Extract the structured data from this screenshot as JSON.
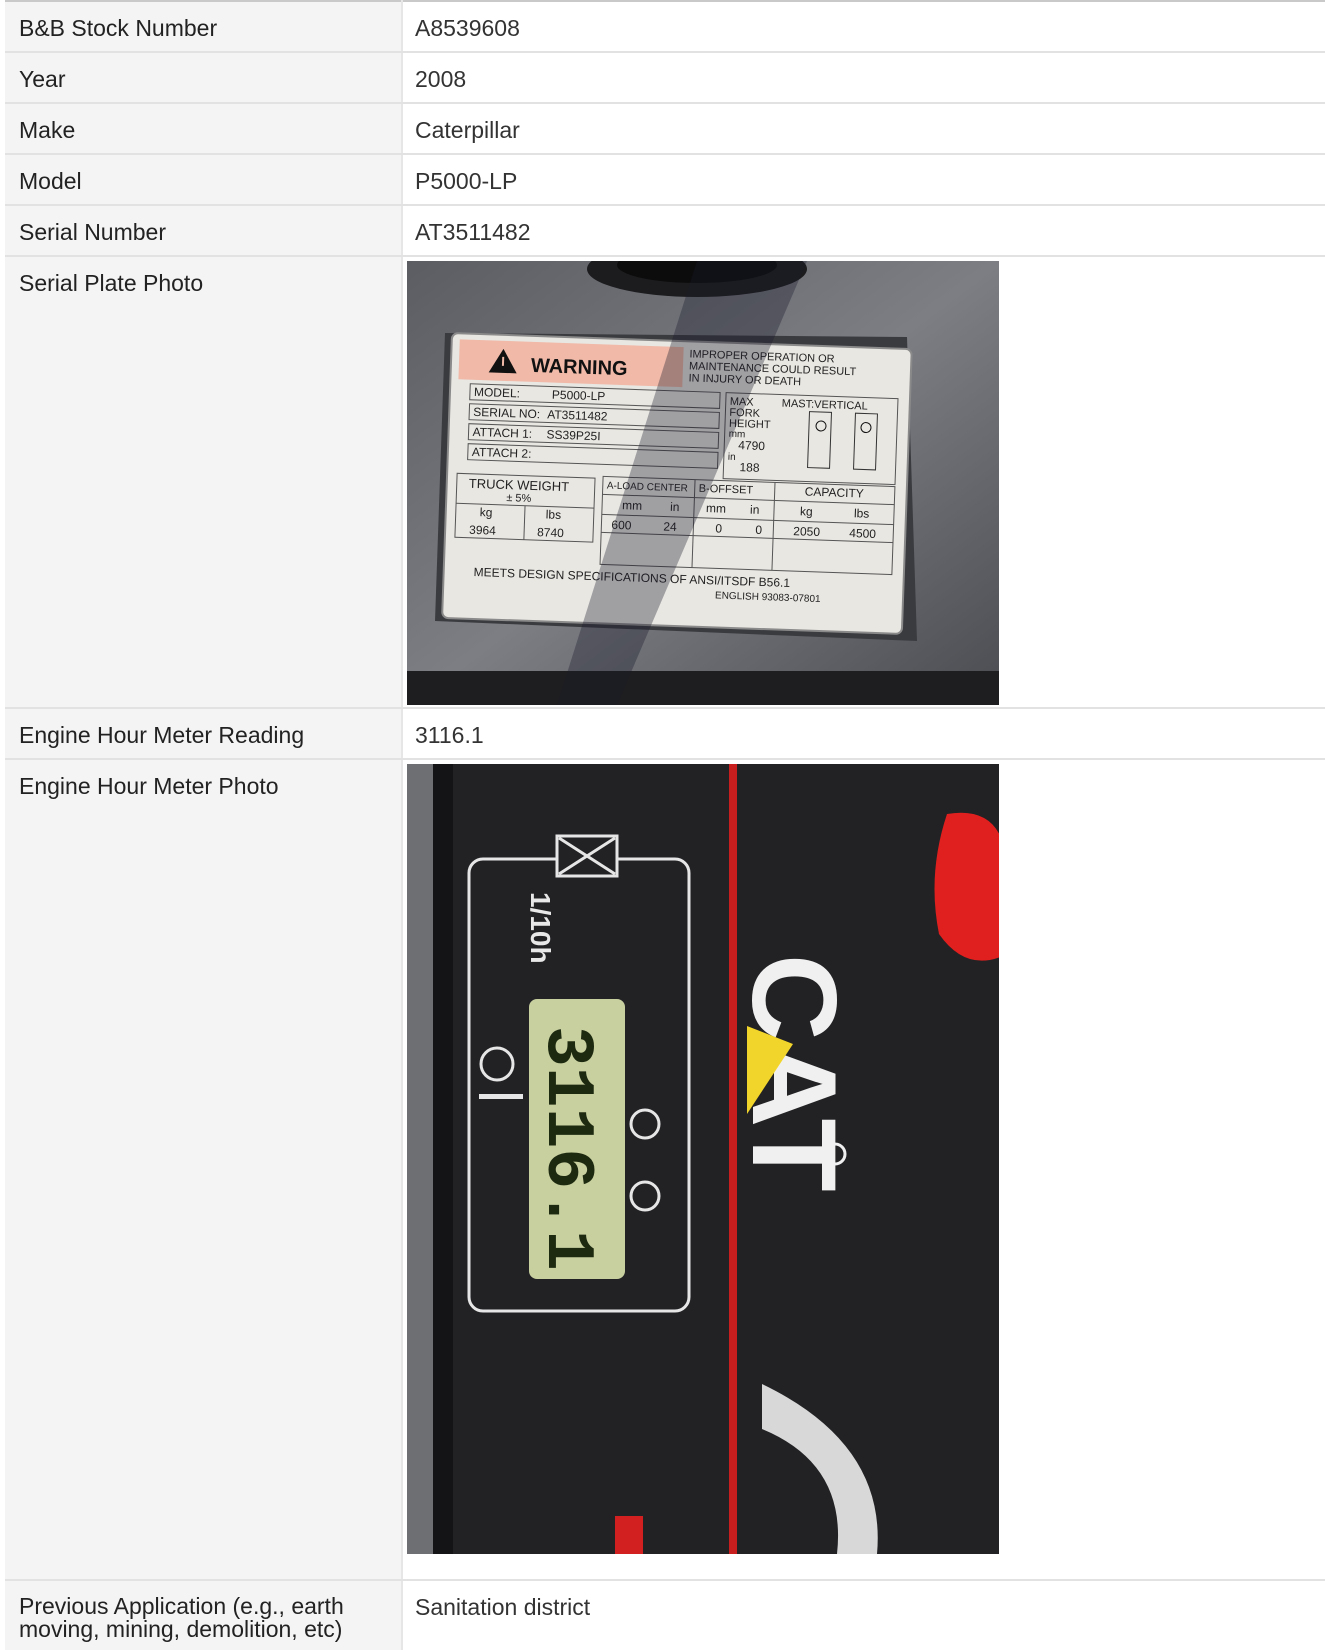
{
  "rows": [
    {
      "label": "B&B Stock Number",
      "value": "A8539608"
    },
    {
      "label": "Year",
      "value": "2008"
    },
    {
      "label": "Make",
      "value": "Caterpillar"
    },
    {
      "label": "Model",
      "value": "P5000-LP"
    },
    {
      "label": "Serial Number",
      "value": "AT3511482"
    },
    {
      "label": "Serial Plate Photo"
    },
    {
      "label": "Engine Hour Meter Reading",
      "value": "3116.1"
    },
    {
      "label": "Engine Hour Meter Photo"
    },
    {
      "label": "Previous Application (e.g., earth moving, mining, demolition, etc)",
      "value": "Sanitation district"
    }
  ],
  "serial_plate": {
    "warning": "WARNING",
    "warning_text": [
      "IMPROPER OPERATION OR",
      "MAINTENANCE COULD RESULT",
      "IN INJURY OR DEATH"
    ],
    "model_label": "MODEL:",
    "model_value": "P5000-LP",
    "serial_label": "SERIAL NO:",
    "serial_value": "AT3511482",
    "attach1_label": "ATTACH 1:",
    "attach1_value": "SS39P25I",
    "attach2_label": "ATTACH 2:",
    "max_fork_height": [
      "MAX",
      "FORK",
      "HEIGHT"
    ],
    "mm_label": "mm",
    "height_mm": "4790",
    "in_label": "in",
    "height_in": "188",
    "mast": "MAST:VERTICAL",
    "truck_weight": "TRUCK WEIGHT",
    "tolerance": "± 5%",
    "kg_label": "kg",
    "lbs_label": "lbs",
    "weight_kg": "3964",
    "weight_lbs": "8740",
    "load_center": "A-LOAD CENTER",
    "b_offset": "B-OFFSET",
    "capacity": "CAPACITY",
    "load_mm": "600",
    "load_in": "24",
    "offset_mm": "0",
    "offset_in": "0",
    "cap_kg": "2050",
    "cap_lbs": "4500",
    "meets": "MEETS DESIGN SPECIFICATIONS OF ANSI/ITSDF B56.1",
    "part_no": "ENGLISH 93083-07801"
  },
  "hour_meter": {
    "unit": "1/10h",
    "display": "3116.1",
    "brand": "CAT"
  },
  "colors": {
    "label_bg": "#f4f4f4",
    "border": "#e2e2e2",
    "plate_warning_band": "#f0b9a8",
    "display_green": "#c8d0a0",
    "cat_yellow": "#f2d52a",
    "stripe_red": "#c81e1e"
  }
}
